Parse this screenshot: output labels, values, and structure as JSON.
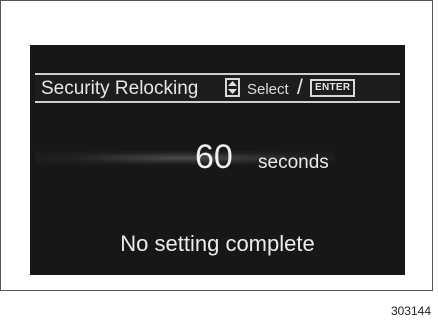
{
  "display": {
    "title": "Security Relocking",
    "select_label": "Select",
    "separator": "/",
    "enter_label": "ENTER",
    "value": "60",
    "unit": "seconds",
    "status": "No setting complete"
  },
  "figure_id": "303144",
  "icons": {
    "select_icon": "up-down-arrow-icon"
  },
  "colors": {
    "screen_background": "#171717",
    "text": "#e6e6e6"
  }
}
